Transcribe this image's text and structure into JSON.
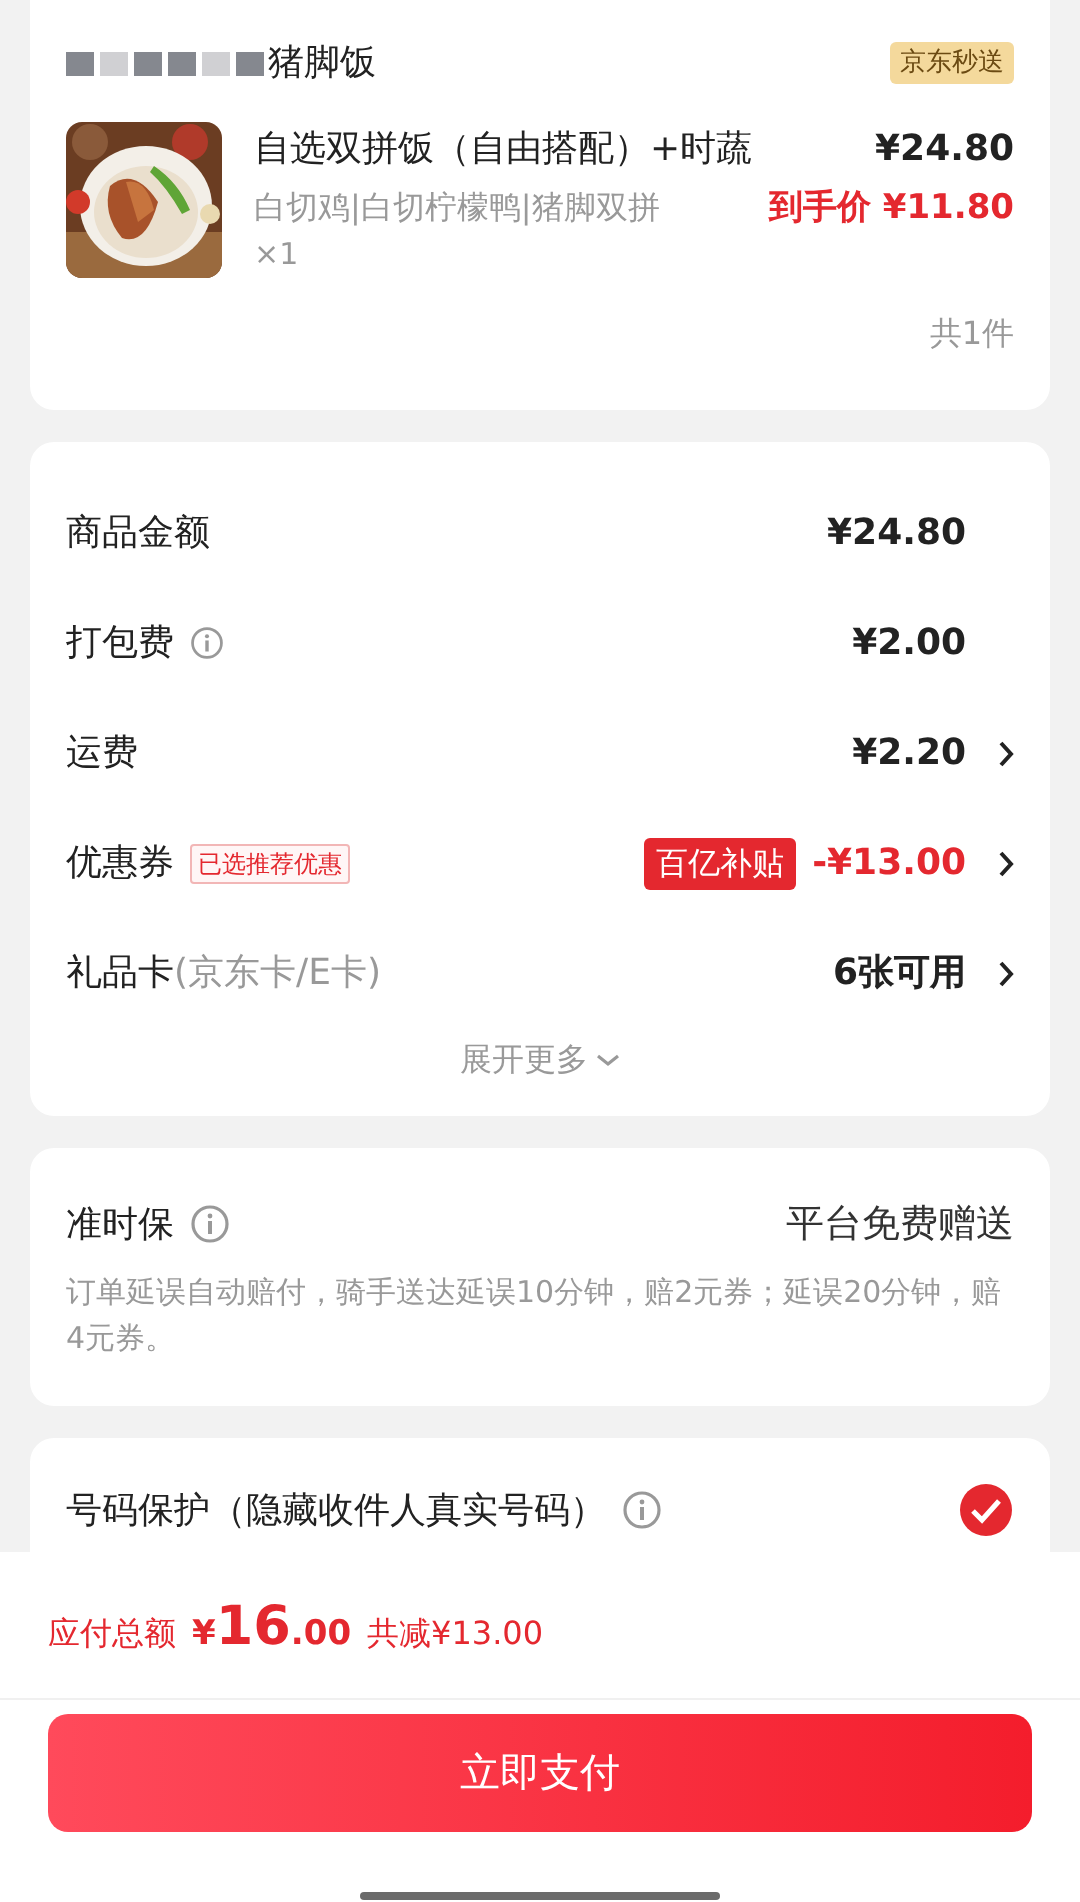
{
  "store": {
    "name": "猪脚饭",
    "badge": "京东秒送"
  },
  "item": {
    "title": "自选双拼饭（自由搭配）+时蔬",
    "price": "¥24.80",
    "specs": "白切鸡|白切柠檬鸭|猪脚双拼",
    "final_label": "到手价",
    "final_price": "¥11.80",
    "quantity": "×1",
    "count": "共1件"
  },
  "fees": [
    {
      "label": "商品金额",
      "info": false,
      "value": "¥24.80",
      "discount": false,
      "chevron": false
    },
    {
      "label": "打包费",
      "info": true,
      "value": "¥2.00",
      "discount": false,
      "chevron": false
    },
    {
      "label": "运费",
      "info": false,
      "value": "¥2.20",
      "discount": false,
      "chevron": true
    },
    {
      "label": "优惠券",
      "info": false,
      "tag": "已选推荐优惠",
      "badge": "百亿补贴",
      "value": "-¥13.00",
      "discount": true,
      "chevron": true
    },
    {
      "label": "礼品卡",
      "note": "(京东卡/E卡)",
      "info": false,
      "value": "6张可用",
      "discount": false,
      "chevron": true
    }
  ],
  "expand": "展开更多",
  "ontime": {
    "title": "准时保",
    "value": "平台免费赠送",
    "description": "订单延误自动赔付，骑手送达延误10分钟，赔2元券；延误20分钟，赔4元券。"
  },
  "privacy": {
    "title": "号码保护（隐藏收件人真实号码）",
    "checked": true
  },
  "footer": {
    "label": "应付总额",
    "currency": "¥",
    "amount": "16",
    "decimals": ".00",
    "saving": "共减¥13.00",
    "button": "立即支付"
  }
}
